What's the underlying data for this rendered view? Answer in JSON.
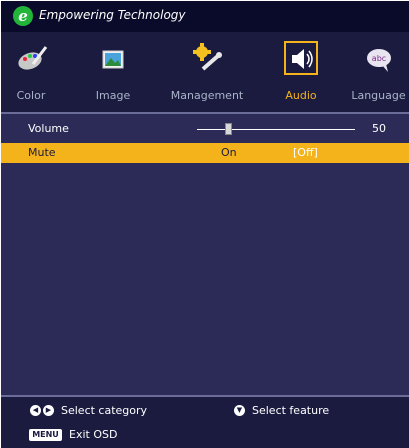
{
  "header": {
    "logo_letter": "e",
    "brand": "Empowering Technology"
  },
  "categories": [
    {
      "label": "Color",
      "icon": "palette-icon",
      "active": false
    },
    {
      "label": "Image",
      "icon": "picture-icon",
      "active": false
    },
    {
      "label": "Management",
      "icon": "gear-wrench-icon",
      "active": false
    },
    {
      "label": "Audio",
      "icon": "speaker-icon",
      "active": true
    },
    {
      "label": "Language",
      "icon": "speech-bubble-icon",
      "active": false
    }
  ],
  "settings": {
    "volume": {
      "label": "Volume",
      "value": "50",
      "level": 0.2
    },
    "mute": {
      "label": "Mute",
      "option_on": "On",
      "option_off": "[Off]",
      "selected": "Off"
    }
  },
  "footer": {
    "select_category": "Select category",
    "select_feature": "Select feature",
    "menu_key": "MENU",
    "exit": "Exit OSD"
  },
  "colors": {
    "background": "#2c2b58",
    "bar": "#1b1b40",
    "highlight": "#f4b31a",
    "logo": "#22b53a"
  }
}
